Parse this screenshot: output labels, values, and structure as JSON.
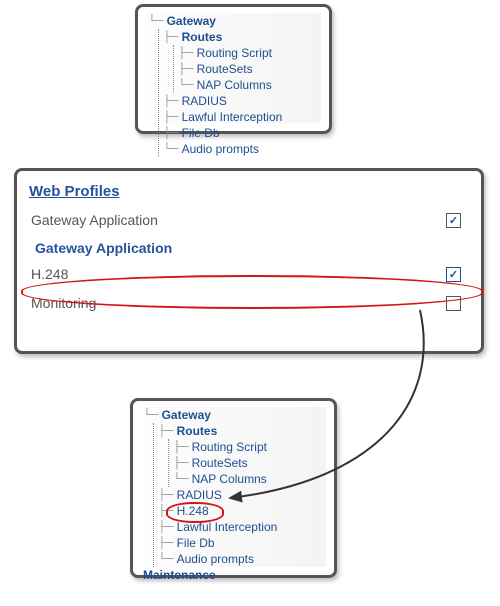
{
  "panel_top": {
    "tree": {
      "root": "Gateway",
      "routes_label": "Routes",
      "children": [
        "Routing Script",
        "RouteSets",
        "NAP Columns"
      ],
      "siblings": [
        "RADIUS",
        "Lawful Interception",
        "File Db",
        "Audio prompts"
      ]
    }
  },
  "panel_mid": {
    "heading": "Web Profiles",
    "row_gateway_app": "Gateway Application",
    "sub_heading": "Gateway Application",
    "row_h248": "H.248",
    "row_monitoring": "Monitoring",
    "checks": {
      "gateway_app": true,
      "h248": true,
      "monitoring": false
    }
  },
  "panel_bottom": {
    "tree": {
      "root": "Gateway",
      "routes_label": "Routes",
      "children": [
        "Routing Script",
        "RouteSets",
        "NAP Columns"
      ],
      "siblings": [
        "RADIUS",
        "H.248",
        "Lawful Interception",
        "File Db",
        "Audio prompts"
      ],
      "maintenance": "Maintenance"
    }
  }
}
